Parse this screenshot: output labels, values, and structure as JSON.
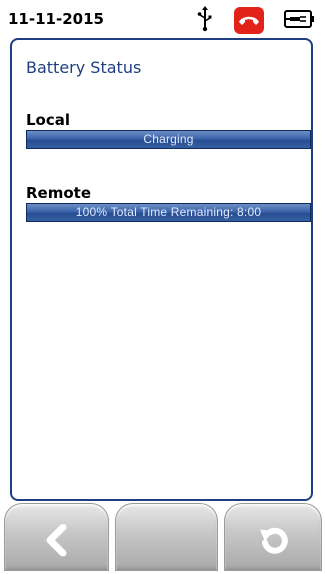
{
  "status_bar": {
    "date": "11-11-2015",
    "icons": [
      "usb-icon",
      "phone-hangup-icon",
      "battery-charging-icon"
    ],
    "phone_color": "#e2231a"
  },
  "panel": {
    "title": "Battery Status",
    "local": {
      "label": "Local",
      "bar_text": "Charging"
    },
    "remote": {
      "label": "Remote",
      "bar_text": "100% Total Time Remaining: 8:00",
      "percent": 100
    }
  },
  "bottom_bar": {
    "buttons": [
      "back-arrow-icon",
      "",
      "refresh-icon"
    ]
  },
  "colors": {
    "accent": "#1f3f83",
    "bar": "#2f5a9e"
  }
}
